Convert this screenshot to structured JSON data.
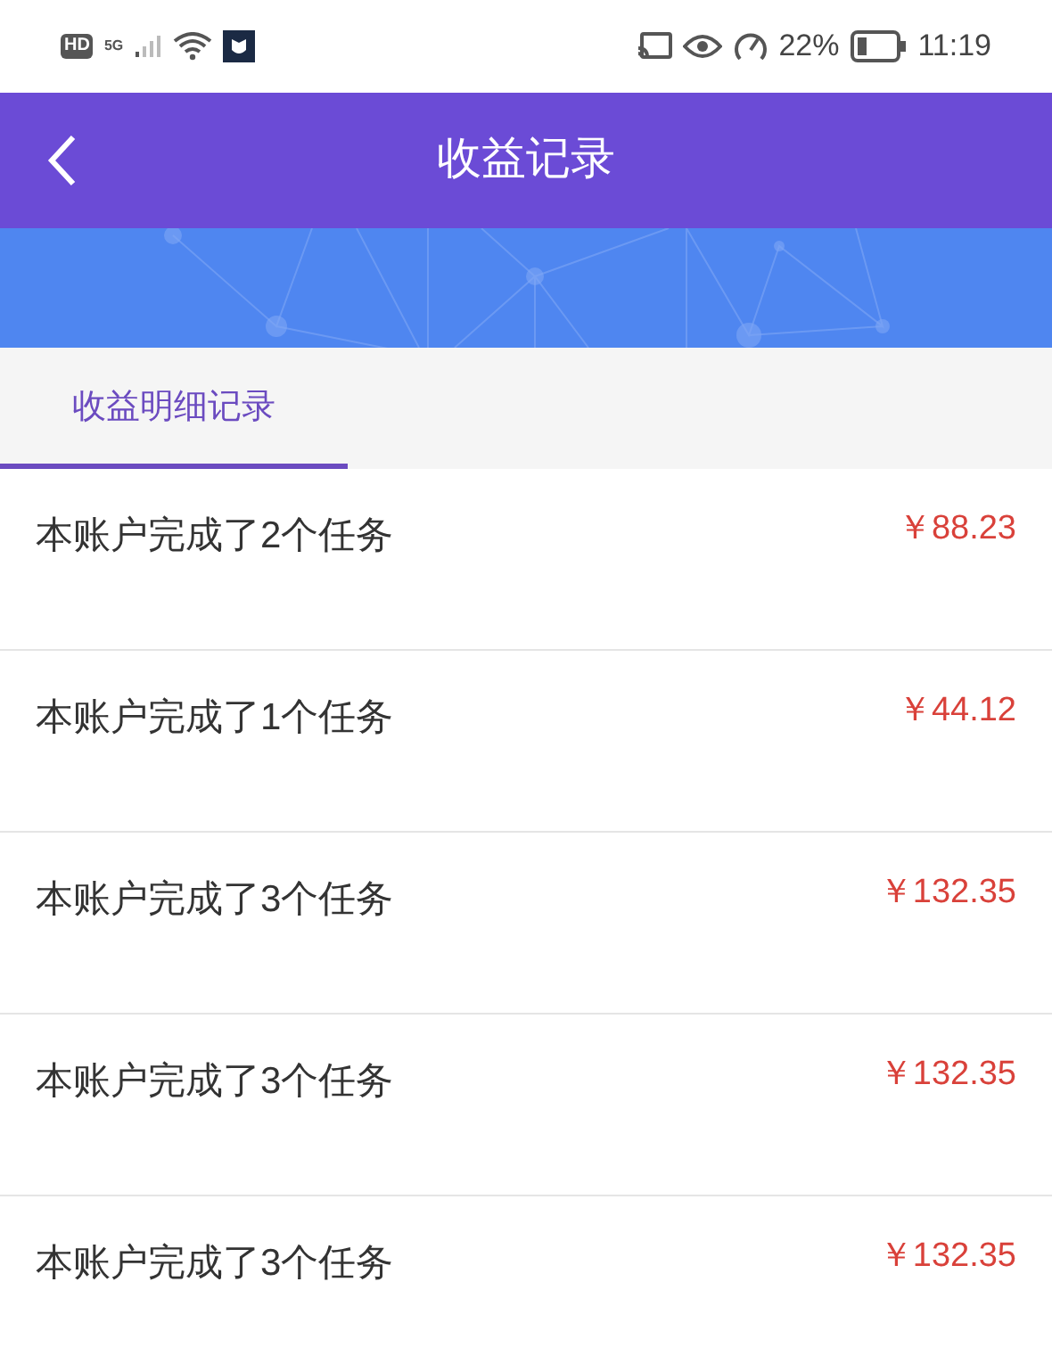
{
  "status_bar": {
    "hd": "HD",
    "network": "5G",
    "battery": "22%",
    "time": "11:19"
  },
  "header": {
    "title": "收益记录"
  },
  "tabs": [
    {
      "label": "收益明细记录",
      "selected": true
    }
  ],
  "records": [
    {
      "text": "本账户完成了2个任务",
      "amount": "￥88.23"
    },
    {
      "text": "本账户完成了1个任务",
      "amount": "￥44.12"
    },
    {
      "text": "本账户完成了3个任务",
      "amount": "￥132.35"
    },
    {
      "text": "本账户完成了3个任务",
      "amount": "￥132.35"
    },
    {
      "text": "本账户完成了3个任务",
      "amount": "￥132.35"
    }
  ]
}
